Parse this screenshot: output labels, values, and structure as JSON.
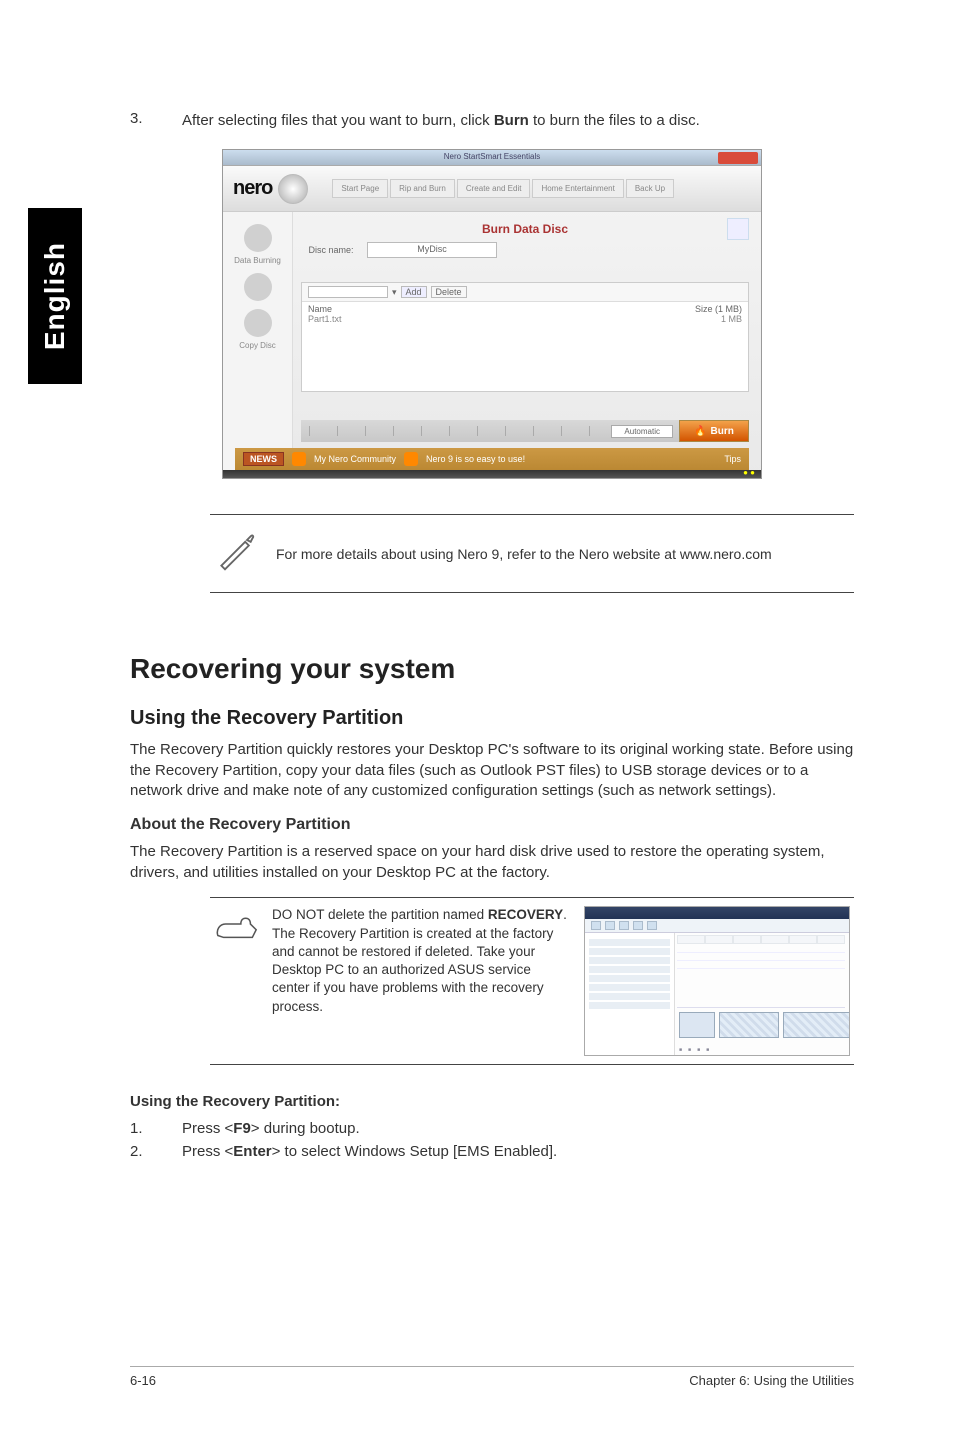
{
  "side_tab": "English",
  "step3": {
    "number": "3.",
    "text_before": "After selecting files that you want to burn, click ",
    "bold_word": "Burn",
    "text_after": " to burn the files to a disc."
  },
  "screenshot": {
    "window_title": "Nero StartSmart Essentials",
    "logo": "nero",
    "tabs": {
      "start": "Start Page",
      "rip": "Rip and Burn",
      "create": "Create and Edit",
      "home": "Home Entertainment",
      "backup": "Back Up"
    },
    "sidebar": {
      "data_burning": "Data Burning",
      "audio": "",
      "copy_disc": "Copy Disc"
    },
    "burn_title": "Burn Data Disc",
    "disc_name_label": "Disc name:",
    "disc_name_value": "MyDisc",
    "toolbar_add": "Add",
    "toolbar_delete": "Delete",
    "list_headers": {
      "name": "Name",
      "size": "Size (1 MB)"
    },
    "list_row": {
      "name": "Part1.txt",
      "size": "1 MB"
    },
    "bottom_select": "Automatic",
    "burn_button": "Burn",
    "news_label": "NEWS",
    "news_item1": "My Nero Community",
    "news_item2": "Nero 9 is so easy to use!",
    "news_right": "Tips"
  },
  "note": {
    "text": "For more details about using Nero 9, refer to the Nero website at www.nero.com"
  },
  "recovering": {
    "heading": "Recovering your system",
    "sub1": "Using the Recovery Partition",
    "para1": "The Recovery Partition quickly restores your Desktop PC's software to its original working state. Before using the Recovery Partition, copy your data files (such as Outlook PST files) to USB storage devices or to a network drive and make note of any customized configuration settings (such as network settings).",
    "about_heading": "About the Recovery Partition",
    "about_para": "The Recovery Partition is a reserved space on your hard disk drive used to restore the operating system, drivers, and utilities installed on your Desktop PC at the factory.",
    "note_before": "DO NOT delete the partition named ",
    "note_bold": "RECOVERY",
    "note_after": ". The Recovery Partition is created at the factory and cannot be restored if deleted. Take your Desktop PC to an authorized ASUS service center if you have problems with the recovery process.",
    "using_heading": "Using the Recovery Partition:",
    "step1_n": "1.",
    "step1_before": "Press <",
    "step1_bold": "F9",
    "step1_after": "> during bootup.",
    "step2_n": "2.",
    "step2_before": "Press <",
    "step2_bold": "Enter",
    "step2_after": "> to select Windows Setup [EMS Enabled]."
  },
  "footer": {
    "left": "6-16",
    "right": "Chapter 6: Using the Utilities"
  },
  "chart_data": null
}
